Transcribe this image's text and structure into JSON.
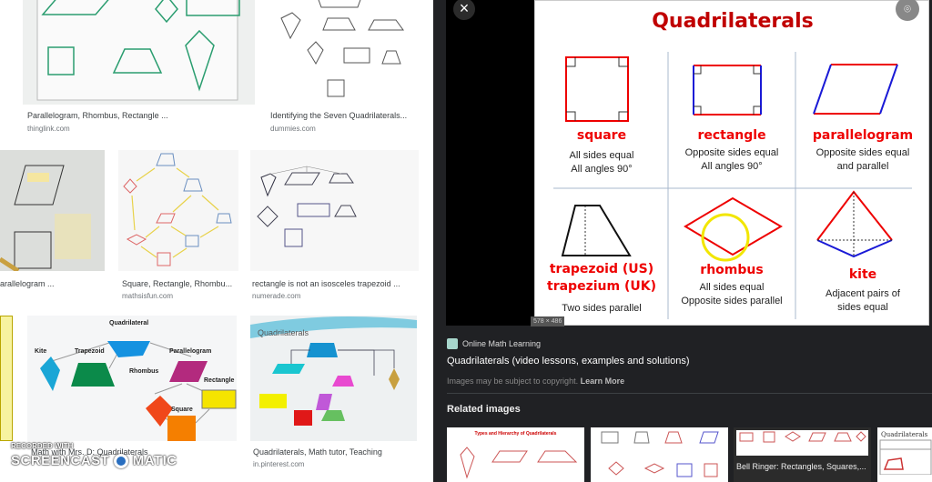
{
  "results": [
    {
      "title": "Parallelogram, Rhombus, Rectangle ...",
      "source": "thinglink.com"
    },
    {
      "title": "Identifying the Seven Quadrilaterals...",
      "source": "dummies.com"
    },
    {
      "title": "arallelogram ...",
      "source": ""
    },
    {
      "title": "Square, Rectangle, Rhombu...",
      "source": "mathsisfun.com"
    },
    {
      "title": "rectangle is not an isosceles trapezoid ...",
      "source": "numerade.com"
    },
    {
      "title": "Math with Mrs. D: Quadrilaterals",
      "source": ""
    },
    {
      "title": "Quadrilaterals, Math tutor, Teaching",
      "source": "in.pinterest.com"
    }
  ],
  "thumb_labels": {
    "hierarchy": [
      "Quadrilateral",
      "Kite",
      "Trapezoid",
      "Parallelogram",
      "Rhombus",
      "Rectangle",
      "Square"
    ],
    "flow_title": "Quadrilaterals"
  },
  "watermark": {
    "line1": "RECORDED WITH",
    "line2a": "SCREENCAST",
    "line2b": "MATIC"
  },
  "preview": {
    "close_icon": "close-icon",
    "lens_icon": "google-lens-icon",
    "title": "Quadrilaterals",
    "dimensions": "578 × 486",
    "shapes": [
      {
        "name": "square",
        "desc": [
          "All sides equal",
          "All angles 90°"
        ]
      },
      {
        "name": "rectangle",
        "desc": [
          "Opposite sides equal",
          "All angles 90°"
        ]
      },
      {
        "name": "parallelogram",
        "desc": [
          "Opposite sides equal",
          "and parallel"
        ]
      },
      {
        "name": "trapezoid (US)",
        "name2": "trapezium (UK)",
        "desc": [
          "Two sides parallel"
        ]
      },
      {
        "name": "rhombus",
        "desc": [
          "All sides equal",
          "Opposite sides parallel"
        ]
      },
      {
        "name": "kite",
        "desc": [
          "Adjacent pairs of",
          "sides equal"
        ]
      }
    ]
  },
  "info": {
    "site": "Online Math Learning",
    "title": "Quadrilaterals (video lessons, examples and solutions)",
    "copyright": "Images may be subject to copyright.",
    "learn_more": "Learn More",
    "related_heading": "Related images"
  },
  "related": [
    {
      "thumb_title": "Types and Hierarchy of Quadrilaterals",
      "caption": ""
    },
    {
      "caption": ""
    },
    {
      "caption": "Bell Ringer: Rectangles, Squares,..."
    },
    {
      "thumb_title": "Quadrilaterals",
      "caption": ""
    }
  ],
  "colors": {
    "red": "#e00000",
    "blue": "#1a1ad6",
    "dark_bg": "#202124",
    "title_red": "#c00000"
  }
}
